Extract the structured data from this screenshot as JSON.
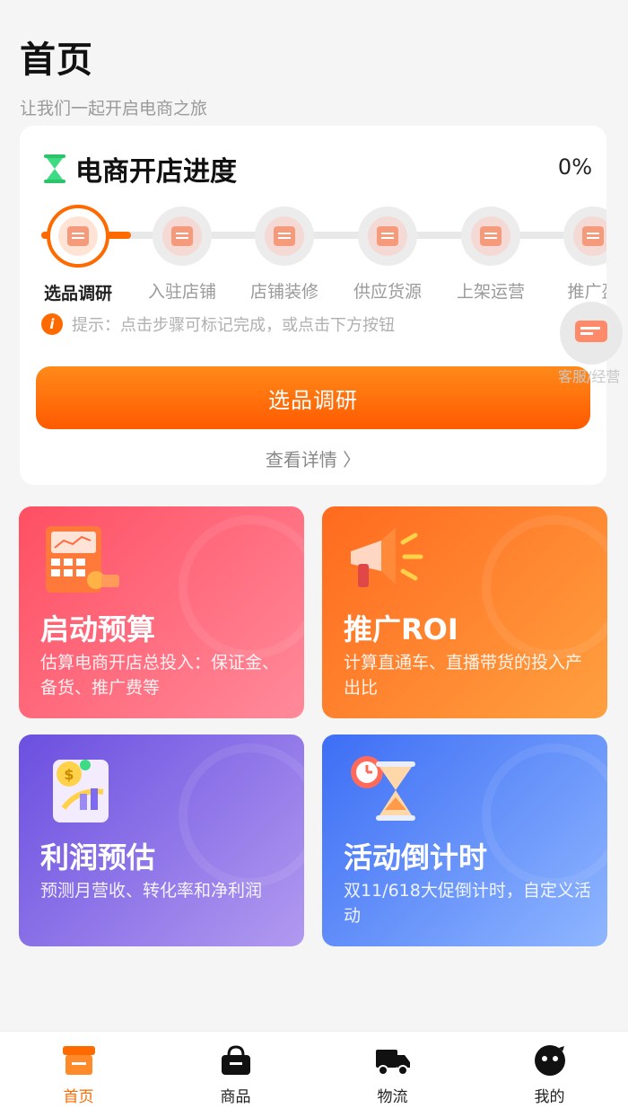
{
  "header": {
    "title": "首页",
    "subtitle": "让我们一起开启电商之旅"
  },
  "progress": {
    "title": "电商开店进度",
    "percent": "0%",
    "steps": [
      {
        "label": "选品调研",
        "active": true
      },
      {
        "label": "入驻店铺"
      },
      {
        "label": "店铺装修"
      },
      {
        "label": "供应货源"
      },
      {
        "label": "上架运营"
      },
      {
        "label": "推广盈"
      }
    ],
    "tip": "提示：点击步骤可标记完成，或点击下方按钮",
    "cta_label": "选品调研",
    "details_label": "查看详情 〉"
  },
  "float_service": {
    "label": "客服/经营"
  },
  "tiles": [
    {
      "title": "启动预算",
      "desc": "估算电商开店总投入：保证金、备货、推广费等"
    },
    {
      "title": "推广ROI",
      "desc": "计算直通车、直播带货的投入产出比"
    },
    {
      "title": "利润预估",
      "desc": "预测月营收、转化率和净利润"
    },
    {
      "title": "活动倒计时",
      "desc": "双11/618大促倒计时，自定义活动"
    }
  ],
  "tabbar": [
    {
      "label": "首页",
      "icon": "store-icon",
      "active": true
    },
    {
      "label": "商品",
      "icon": "basket-icon"
    },
    {
      "label": "物流",
      "icon": "truck-icon"
    },
    {
      "label": "我的",
      "icon": "avatar-icon"
    }
  ],
  "colors": {
    "accent": "#ff6a00",
    "tile1": "#ff4f63",
    "tile2": "#ff6a1f",
    "tile3": "#6b4fe0",
    "tile4": "#3d6ef5"
  }
}
